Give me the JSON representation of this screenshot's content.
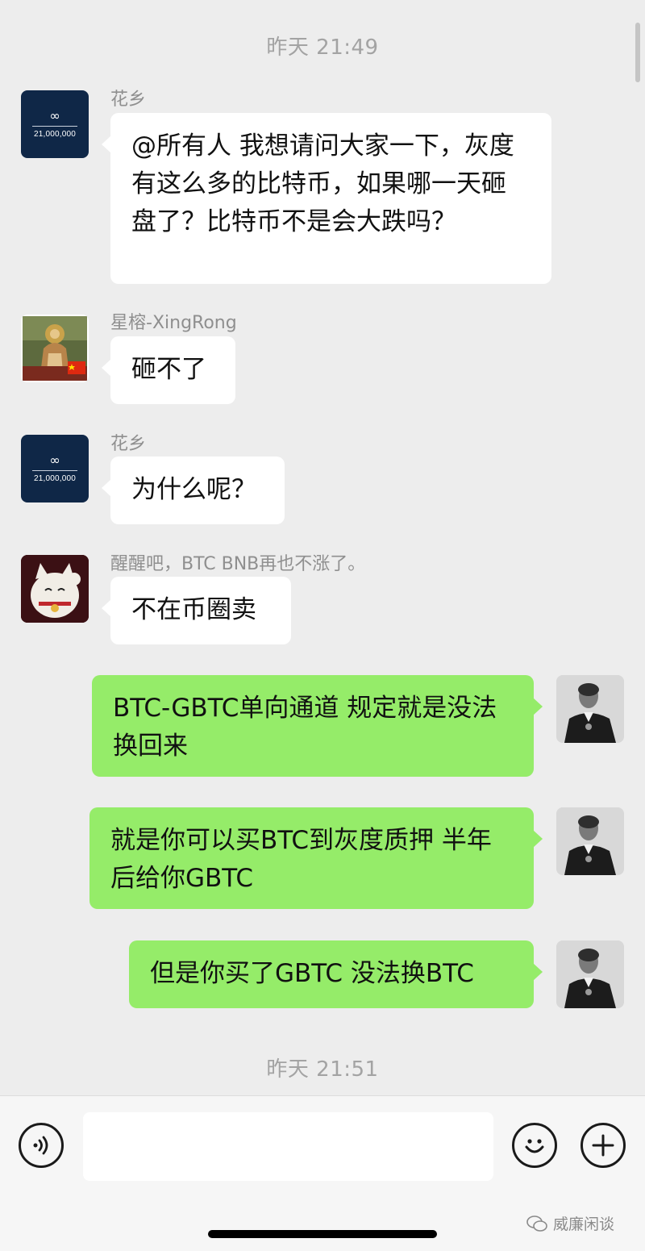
{
  "chat": {
    "time_top": "昨天 21:49",
    "time_bottom": "昨天 21:51",
    "logo_avatar": {
      "symbol": "∞",
      "caption": "21,000,000",
      "bg": "#0f2747"
    },
    "messages": [
      {
        "sender": "花乡",
        "text": "@所有人 我想请问大家一下，灰度有这么多的比特币，如果哪一天砸盘了？比特币不是会大跌吗？"
      },
      {
        "sender": "星榕-XingRong",
        "text": "砸不了"
      },
      {
        "sender": "花乡",
        "text": "为什么呢？"
      },
      {
        "sender": "醒醒吧，BTC BNB再也不涨了。",
        "text": "不在币圈卖"
      },
      {
        "sender": "",
        "text": "BTC-GBTC单向通道 规定就是没法换回来"
      },
      {
        "sender": "",
        "text": "就是你可以买BTC到灰度质押 半年后给你GBTC"
      },
      {
        "sender": "",
        "text": "但是你买了GBTC 没法换BTC"
      }
    ]
  },
  "input_bar": {
    "voice_icon": "voice-icon",
    "emoji_icon": "emoji-icon",
    "plus_icon": "plus-icon",
    "value": ""
  },
  "watermark": {
    "text": "威廉闲谈",
    "icon": "wechat-icon"
  },
  "colors": {
    "background": "#ededed",
    "incoming": "#ffffff",
    "outgoing": "#95ec69",
    "meta": "#a3a3a3"
  }
}
